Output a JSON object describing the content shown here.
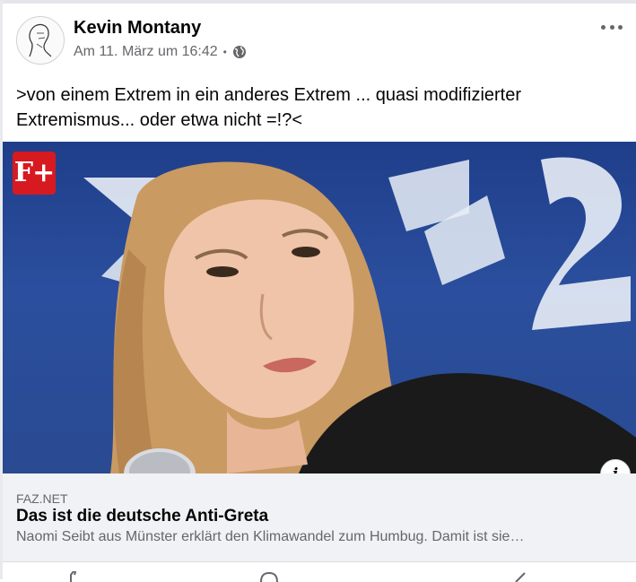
{
  "post": {
    "author": "Kevin Montany",
    "timestamp": "Am 11. März um 16:42",
    "separator": "•",
    "audience_icon": "globe-icon",
    "text": ">von einem Extrem in ein anderes Extrem ... quasi modifizierter Extremismus... oder etwa nicht =!?<",
    "more_icon": "more-options-icon"
  },
  "link_preview": {
    "badge_text": "F+",
    "domain": "FAZ.NET",
    "title": "Das ist die deutsche Anti-Greta",
    "description": "Naomi Seibt aus Münster erklärt den Klimawandel zum Humbug. Damit ist sie…",
    "info_label": "i"
  },
  "colors": {
    "badge": "#d71920",
    "secondary_text": "#65676b",
    "link_background": "#f0f2f5",
    "hero_background": "#2b4f9e"
  }
}
